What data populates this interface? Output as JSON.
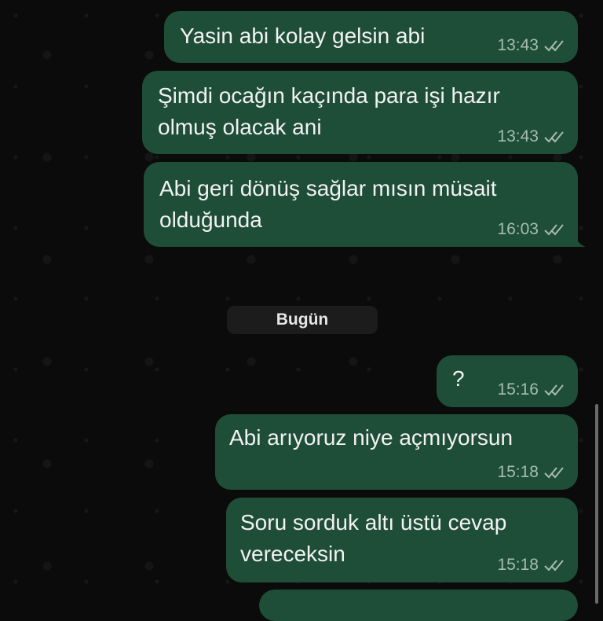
{
  "date_divider": "Bugün",
  "messages": [
    {
      "text_lines": [
        "Yasin abi kolay gelsin abi"
      ],
      "time": "13:43",
      "status": "read"
    },
    {
      "text_lines": [
        "Şimdi ocağın kaçında para işi hazır",
        "olmuş olacak ani"
      ],
      "time": "13:43",
      "status": "read"
    },
    {
      "text_lines": [
        "Abi geri dönüş sağlar mısın müsait",
        "olduğunda"
      ],
      "time": "16:03",
      "status": "read"
    },
    {
      "text_lines": [
        "?"
      ],
      "time": "15:16",
      "status": "read"
    },
    {
      "text_lines": [
        "Abi arıyoruz niye açmıyorsun"
      ],
      "time": "15:18",
      "status": "read"
    },
    {
      "text_lines": [
        "Soru sorduk altı üstü cevap",
        "vereceksin"
      ],
      "time": "15:18",
      "status": "read"
    }
  ],
  "colors": {
    "outgoing_bubble": "#1e4e38",
    "background": "#0b0b0b",
    "tick": "#a6bcb0"
  },
  "icons": {
    "status": "double-check-icon"
  }
}
